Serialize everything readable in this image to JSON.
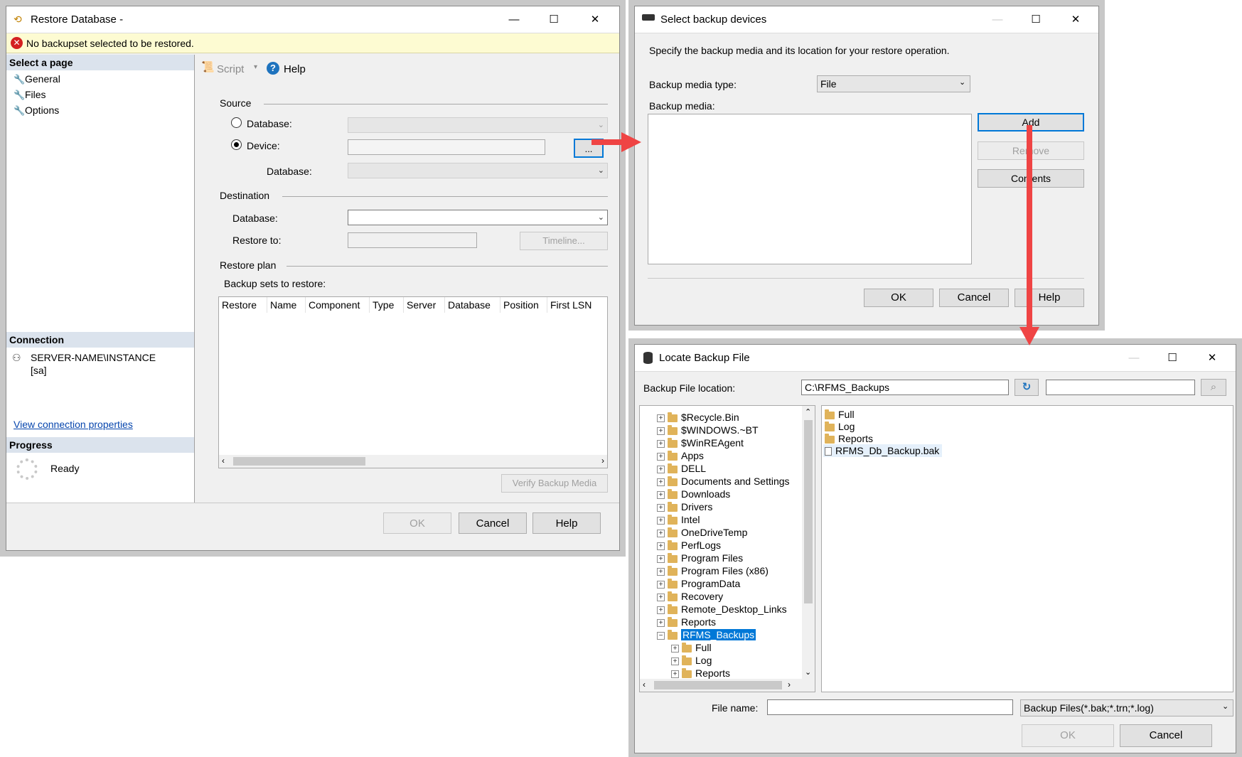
{
  "restore_window": {
    "title": "Restore Database -",
    "error_message": "No backupset selected to be restored.",
    "select_page_header": "Select a page",
    "pages": [
      {
        "label": "General"
      },
      {
        "label": "Files"
      },
      {
        "label": "Options"
      }
    ],
    "toolbar": {
      "script_label": "Script",
      "help_label": "Help"
    },
    "source": {
      "section_label": "Source",
      "database_radio_label": "Database:",
      "device_radio_label": "Device:",
      "device_value": "",
      "browse_button": "...",
      "database_label": "Database:"
    },
    "destination": {
      "section_label": "Destination",
      "database_label": "Database:",
      "restore_to_label": "Restore to:",
      "timeline_button": "Timeline..."
    },
    "restore_plan": {
      "section_label": "Restore plan",
      "backup_sets_label": "Backup sets to restore:",
      "columns": [
        "Restore",
        "Name",
        "Component",
        "Type",
        "Server",
        "Database",
        "Position",
        "First LSN"
      ],
      "verify_button": "Verify Backup Media"
    },
    "connection": {
      "header": "Connection",
      "server": "SERVER-NAME\\INSTANCE",
      "user": "[sa]",
      "view_properties_link": "View connection properties"
    },
    "progress": {
      "header": "Progress",
      "status": "Ready"
    },
    "buttons": {
      "ok": "OK",
      "cancel": "Cancel",
      "help": "Help"
    }
  },
  "select_devices_window": {
    "title": "Select backup devices",
    "instruction": "Specify the backup media and its location for your restore operation.",
    "media_type_label": "Backup media type:",
    "media_type_value": "File",
    "backup_media_label": "Backup media:",
    "add_button": "Add",
    "remove_button": "Remove",
    "contents_button": "Contents",
    "buttons": {
      "ok": "OK",
      "cancel": "Cancel",
      "help": "Help"
    }
  },
  "locate_window": {
    "title": "Locate Backup File",
    "location_label": "Backup File location:",
    "location_value": "C:\\RFMS_Backups",
    "search_value": "",
    "tree": [
      {
        "label": "$Recycle.Bin"
      },
      {
        "label": "$WINDOWS.~BT"
      },
      {
        "label": "$WinREAgent"
      },
      {
        "label": "Apps"
      },
      {
        "label": "DELL"
      },
      {
        "label": "Documents and Settings"
      },
      {
        "label": "Downloads"
      },
      {
        "label": "Drivers"
      },
      {
        "label": "Intel"
      },
      {
        "label": "OneDriveTemp"
      },
      {
        "label": "PerfLogs"
      },
      {
        "label": "Program Files"
      },
      {
        "label": "Program Files (x86)"
      },
      {
        "label": "ProgramData"
      },
      {
        "label": "Recovery"
      },
      {
        "label": "Remote_Desktop_Links"
      },
      {
        "label": "Reports"
      },
      {
        "label": "RFMS_Backups"
      }
    ],
    "tree_children": [
      {
        "label": "Full"
      },
      {
        "label": "Log"
      },
      {
        "label": "Reports"
      }
    ],
    "files": [
      {
        "label": "Full"
      },
      {
        "label": "Log"
      },
      {
        "label": "Reports"
      },
      {
        "label": "RFMS_Db_Backup.bak"
      }
    ],
    "file_name_label": "File name:",
    "file_name_value": "",
    "filter_value": "Backup Files(*.bak;*.trn;*.log)",
    "buttons": {
      "ok": "OK",
      "cancel": "Cancel"
    }
  }
}
